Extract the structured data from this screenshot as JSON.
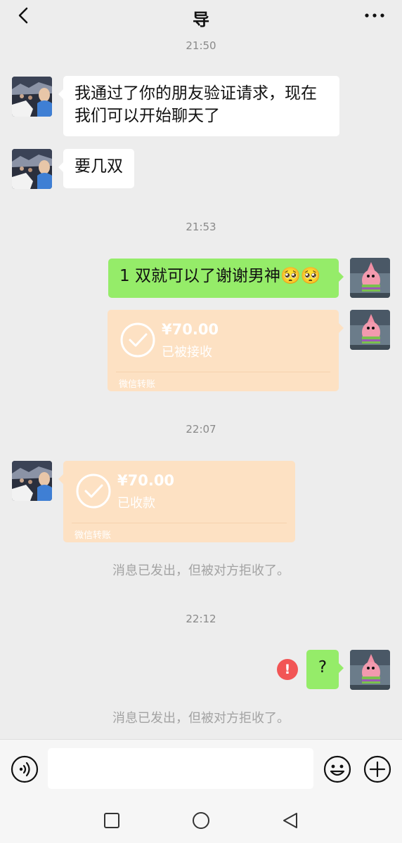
{
  "header": {
    "title": "导"
  },
  "colors": {
    "background": "#ededed",
    "bubble_green": "#95ec69",
    "bubble_white": "#ffffff",
    "transfer_bg": "#fde1c3",
    "error_red": "#f25555"
  },
  "messages": {
    "time1": "21:50",
    "msg1_line1": "我通过了你的朋友验证请求，现在",
    "msg1_line2": "我们可以开始聊天了",
    "msg2": "要几双",
    "time2": "21:53",
    "msg3": "1 双就可以了谢谢男神🥺🥺",
    "transfer1": {
      "amount": "¥70.00",
      "status": "已被接收",
      "footer": "微信转账"
    },
    "time3": "22:07",
    "transfer2": {
      "amount": "¥70.00",
      "status": "已收款",
      "footer": "微信转账"
    },
    "system1": "消息已发出，但被对方拒收了。",
    "time4": "22:12",
    "msg4": "?",
    "error_icon": "!",
    "system2": "消息已发出，但被对方拒收了。"
  },
  "icons": {
    "back": "chevron-left-icon",
    "more": "more-dots-icon",
    "voice": "voice-icon",
    "emoji": "emoji-icon",
    "add": "plus-icon",
    "check": "check-circle-icon",
    "nav_square": "square-icon",
    "nav_circle": "circle-icon",
    "nav_back": "triangle-back-icon"
  },
  "composer": {
    "value": ""
  }
}
